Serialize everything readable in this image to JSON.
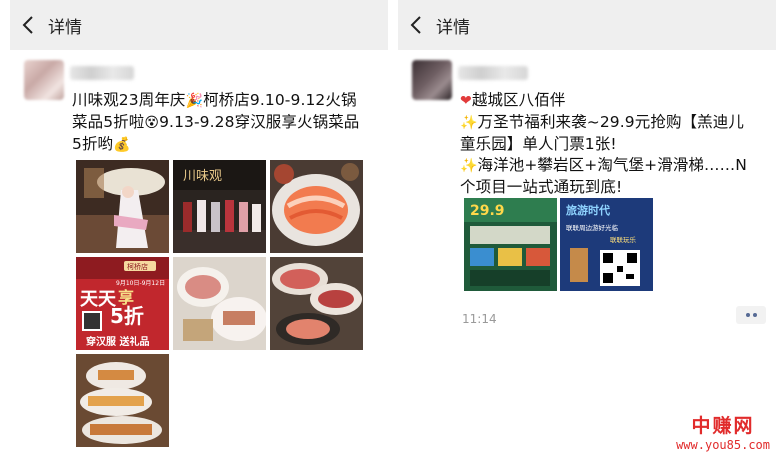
{
  "nav": {
    "back_icon": "chevron-left-icon",
    "title": "详情"
  },
  "posts": [
    {
      "text_lines": [
        "川味观23周年庆",
        "柯桥店9.10-9.12火锅",
        "菜品5折啦",
        "9.13-9.28穿汉服享火锅菜品",
        "5折哟"
      ],
      "images": [
        "hanfu-girl-umbrella",
        "restaurant-storefront-group",
        "seafood-platter",
        "promo-poster",
        "food-plates",
        "meat-platter",
        "fried-dishes"
      ],
      "poster": {
        "badge": "柯桥店",
        "dates": "9月10日-9月12日",
        "headline1": "天天",
        "headline2": "享",
        "headline3": "5折",
        "footer": "穿汉服 送礼品"
      },
      "store_sign": "川味观"
    },
    {
      "title": "越城区八佰伴",
      "text_lines": [
        "万圣节福利来袭~29.9元抢购【羔迪儿",
        "童乐园】单人门票1张!",
        "海洋池+攀岩区+淘气堡+滑滑梯……N",
        "个项目一站式通玩到底!"
      ],
      "poster_price": "29.9",
      "poster2_title": "旅游时代",
      "poster2_sub": "联联周边游好光临",
      "poster2_code": "联联玩乐",
      "time": "11:14"
    }
  ],
  "watermark": {
    "logo": "中赚网",
    "url": "www.you85.com"
  },
  "colors": {
    "link": "#576b95",
    "watermark": "#e12b2b",
    "navbar": "#efefef"
  }
}
